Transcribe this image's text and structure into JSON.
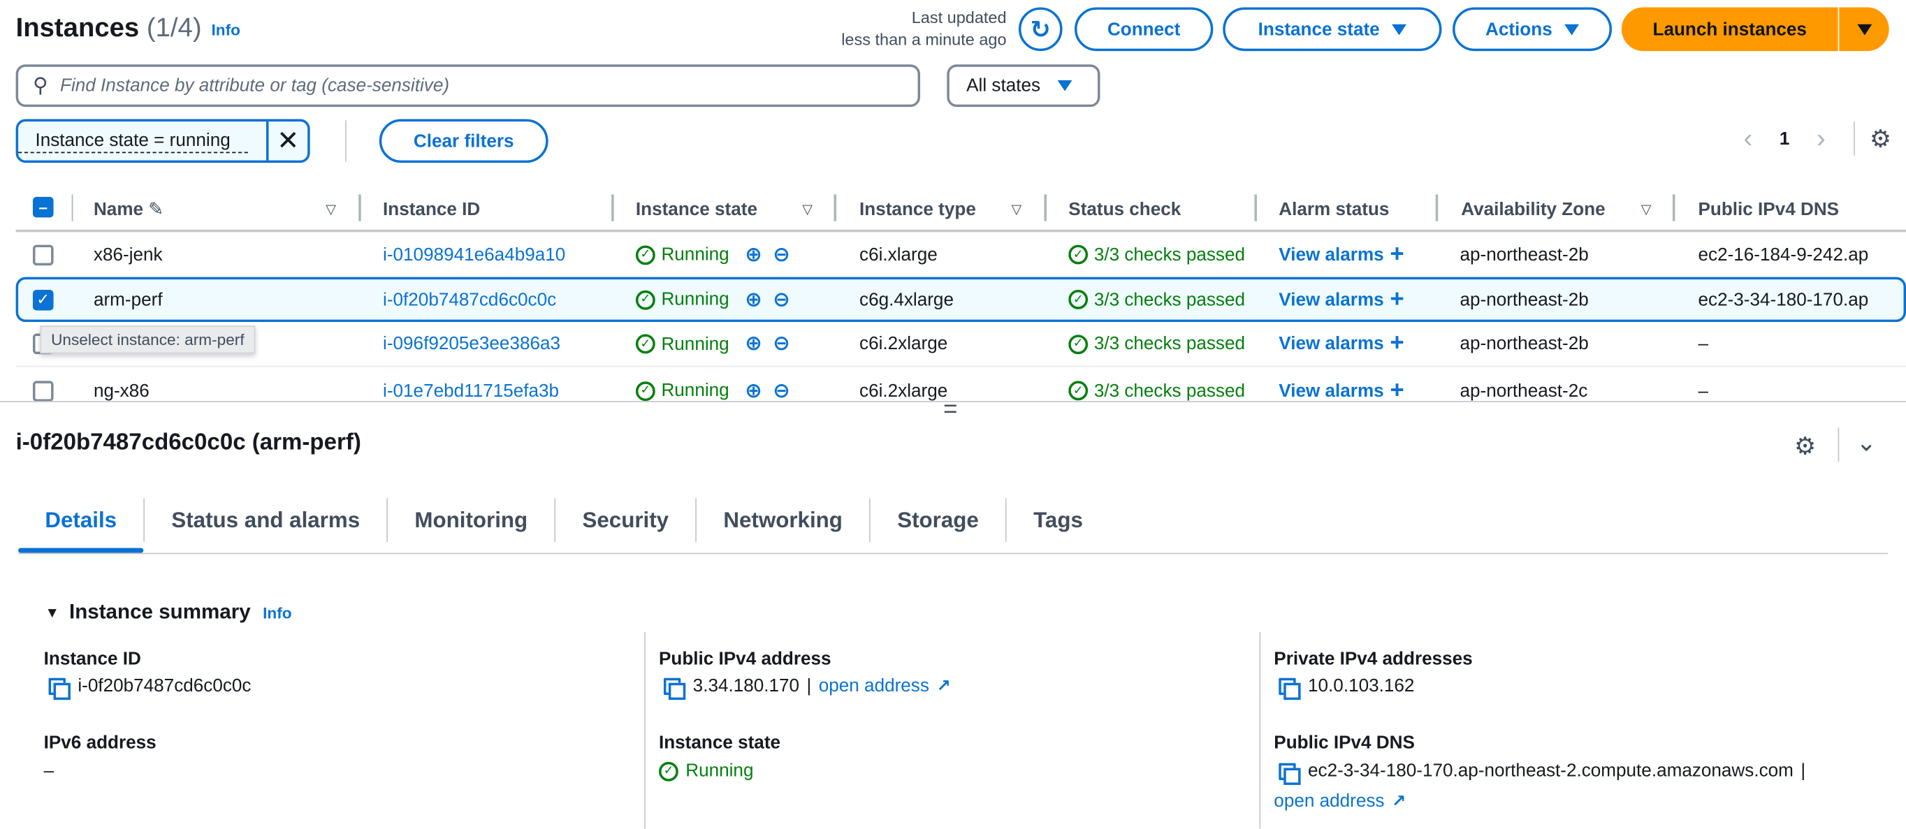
{
  "header": {
    "title": "Instances",
    "count": "(1/4)",
    "info": "Info",
    "last_updated_line1": "Last updated",
    "last_updated_line2": "less than a minute ago",
    "connect": "Connect",
    "instance_state": "Instance state",
    "actions": "Actions",
    "launch": "Launch instances"
  },
  "search": {
    "placeholder": "Find Instance by attribute or tag (case-sensitive)",
    "state_filter": "All states"
  },
  "filters": {
    "chip": "Instance state = running",
    "clear": "Clear filters"
  },
  "pagination": {
    "page": "1"
  },
  "table": {
    "columns": [
      "Name",
      "Instance ID",
      "Instance state",
      "Instance type",
      "Status check",
      "Alarm status",
      "Availability Zone",
      "Public IPv4 DNS"
    ],
    "rows": [
      {
        "name": "x86-jenk",
        "id": "i-01098941e6a4b9a10",
        "state": "Running",
        "type": "c6i.xlarge",
        "status": "3/3 checks passed",
        "alarm": "View alarms",
        "az": "ap-northeast-2b",
        "dns": "ec2-16-184-9-242.ap",
        "selected": false
      },
      {
        "name": "arm-perf",
        "id": "i-0f20b7487cd6c0c0c",
        "state": "Running",
        "type": "c6g.4xlarge",
        "status": "3/3 checks passed",
        "alarm": "View alarms",
        "az": "ap-northeast-2b",
        "dns": "ec2-3-34-180-170.ap",
        "selected": true
      },
      {
        "name": "",
        "id": "i-096f9205e3ee386a3",
        "state": "Running",
        "type": "c6i.2xlarge",
        "status": "3/3 checks passed",
        "alarm": "View alarms",
        "az": "ap-northeast-2b",
        "dns": "–",
        "selected": false
      },
      {
        "name": "ng-x86",
        "id": "i-01e7ebd11715efa3b",
        "state": "Running",
        "type": "c6i.2xlarge",
        "status": "3/3 checks passed",
        "alarm": "View alarms",
        "az": "ap-northeast-2c",
        "dns": "–",
        "selected": false
      }
    ],
    "tooltip": "Unselect instance: arm-perf"
  },
  "details": {
    "title": "i-0f20b7487cd6c0c0c (arm-perf)",
    "tabs": [
      "Details",
      "Status and alarms",
      "Monitoring",
      "Security",
      "Networking",
      "Storage",
      "Tags"
    ],
    "summary_title": "Instance summary",
    "info": "Info",
    "instance_id_label": "Instance ID",
    "instance_id": "i-0f20b7487cd6c0c0c",
    "ipv6_label": "IPv6 address",
    "ipv6": "–",
    "public_ip_label": "Public IPv4 address",
    "public_ip": "3.34.180.170",
    "open_address": "open address",
    "state_label": "Instance state",
    "state": "Running",
    "private_ip_label": "Private IPv4 addresses",
    "private_ip": "10.0.103.162",
    "public_dns_label": "Public IPv4 DNS",
    "public_dns": "ec2-3-34-180-170.ap-northeast-2.compute.amazonaws.com"
  },
  "colors": {
    "accent": "#0972d3",
    "success": "#037f0c",
    "launch": "#ff9900"
  }
}
